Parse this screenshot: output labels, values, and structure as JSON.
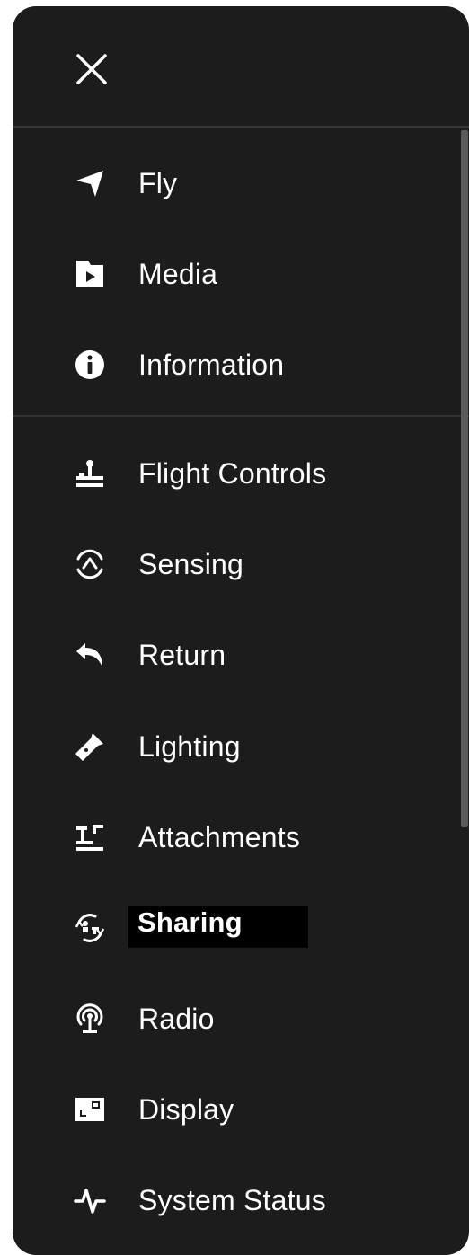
{
  "menu": {
    "close_icon": "close-icon",
    "primary_items": [
      {
        "label": "Fly",
        "icon": "fly-arrow-icon"
      },
      {
        "label": "Media",
        "icon": "media-icon"
      },
      {
        "label": "Information",
        "icon": "info-icon"
      }
    ],
    "settings_items": [
      {
        "label": "Flight Controls",
        "icon": "joystick-icon"
      },
      {
        "label": "Sensing",
        "icon": "sensing-icon"
      },
      {
        "label": "Return",
        "icon": "return-icon"
      },
      {
        "label": "Lighting",
        "icon": "flashlight-icon"
      },
      {
        "label": "Attachments",
        "icon": "attachments-icon"
      },
      {
        "label": "Sharing",
        "icon": "sharing-icon",
        "selected": true
      },
      {
        "label": "Radio",
        "icon": "radio-icon"
      },
      {
        "label": "Display",
        "icon": "display-icon"
      },
      {
        "label": "System Status",
        "icon": "pulse-icon"
      }
    ]
  },
  "colors": {
    "panel_bg": "#1c1c1c",
    "text": "#ffffff",
    "divider": "#333333",
    "selected_bg": "#000000"
  }
}
